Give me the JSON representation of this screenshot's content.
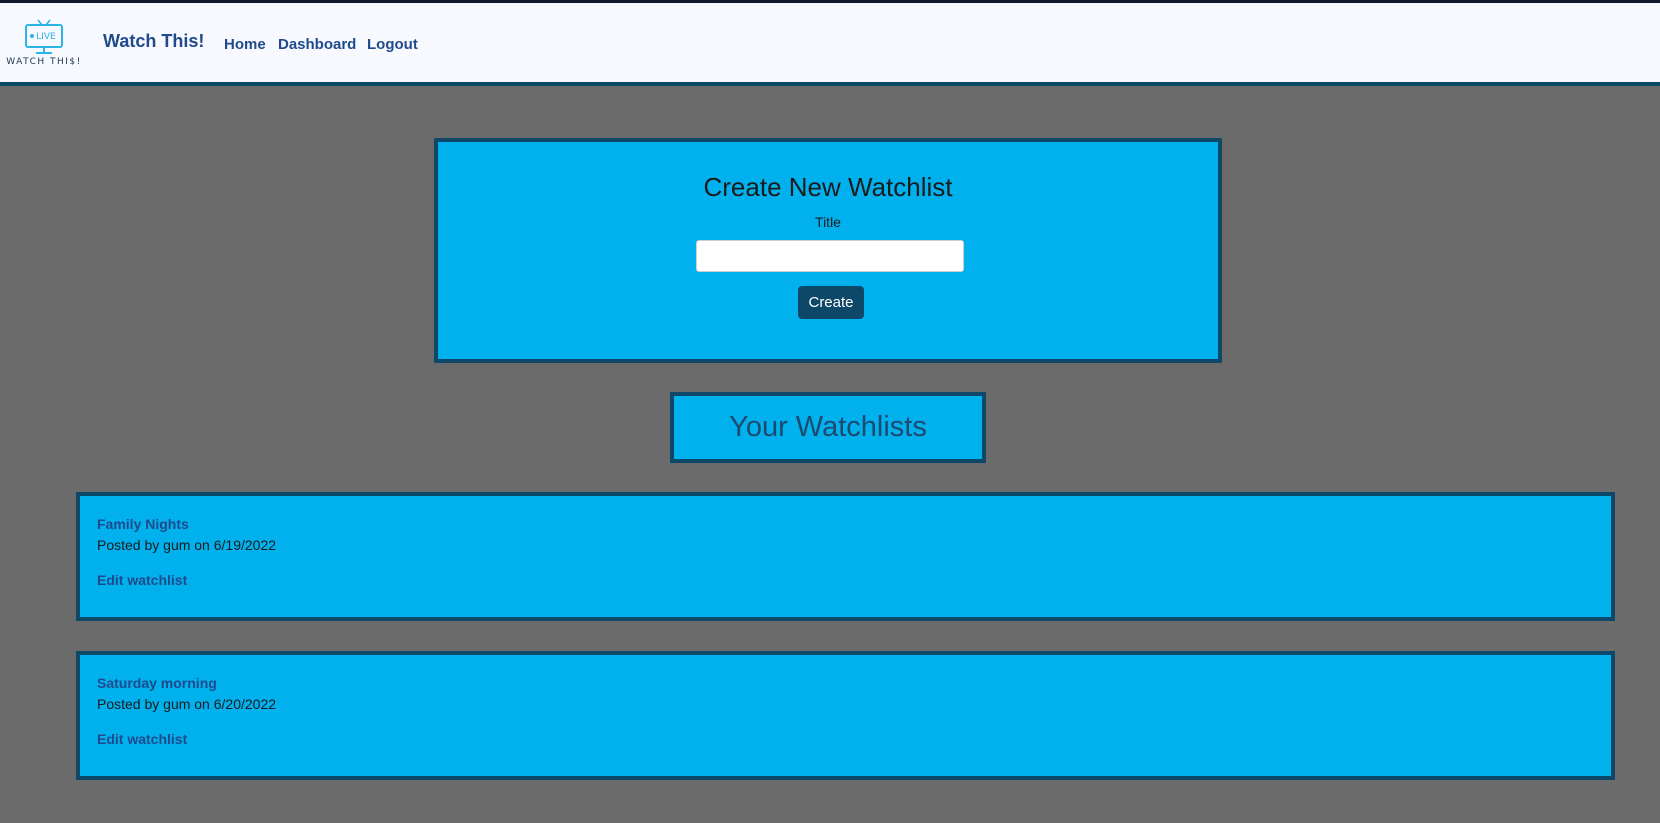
{
  "navbar": {
    "logo_text": "WATCH THI$!",
    "logo_badge": "LIVE",
    "brand": "Watch This!",
    "links": [
      "Home",
      "Dashboard",
      "Logout"
    ]
  },
  "create_form": {
    "heading": "Create New Watchlist",
    "title_label": "Title",
    "title_value": "",
    "title_placeholder": "",
    "submit_label": "Create"
  },
  "watchlists_section": {
    "heading": "Your Watchlists",
    "items": [
      {
        "title": "Family Nights",
        "meta": "Posted by gum on 6/19/2022",
        "edit_label": "Edit watchlist"
      },
      {
        "title": "Saturday morning",
        "meta": "Posted by gum on 6/20/2022",
        "edit_label": "Edit watchlist"
      }
    ]
  },
  "colors": {
    "page_background": "#6b6b6b",
    "card_background": "#00b1ee",
    "card_border": "#0e4868",
    "link": "#1f4a8c",
    "navbar_background": "#f8f8ff"
  }
}
